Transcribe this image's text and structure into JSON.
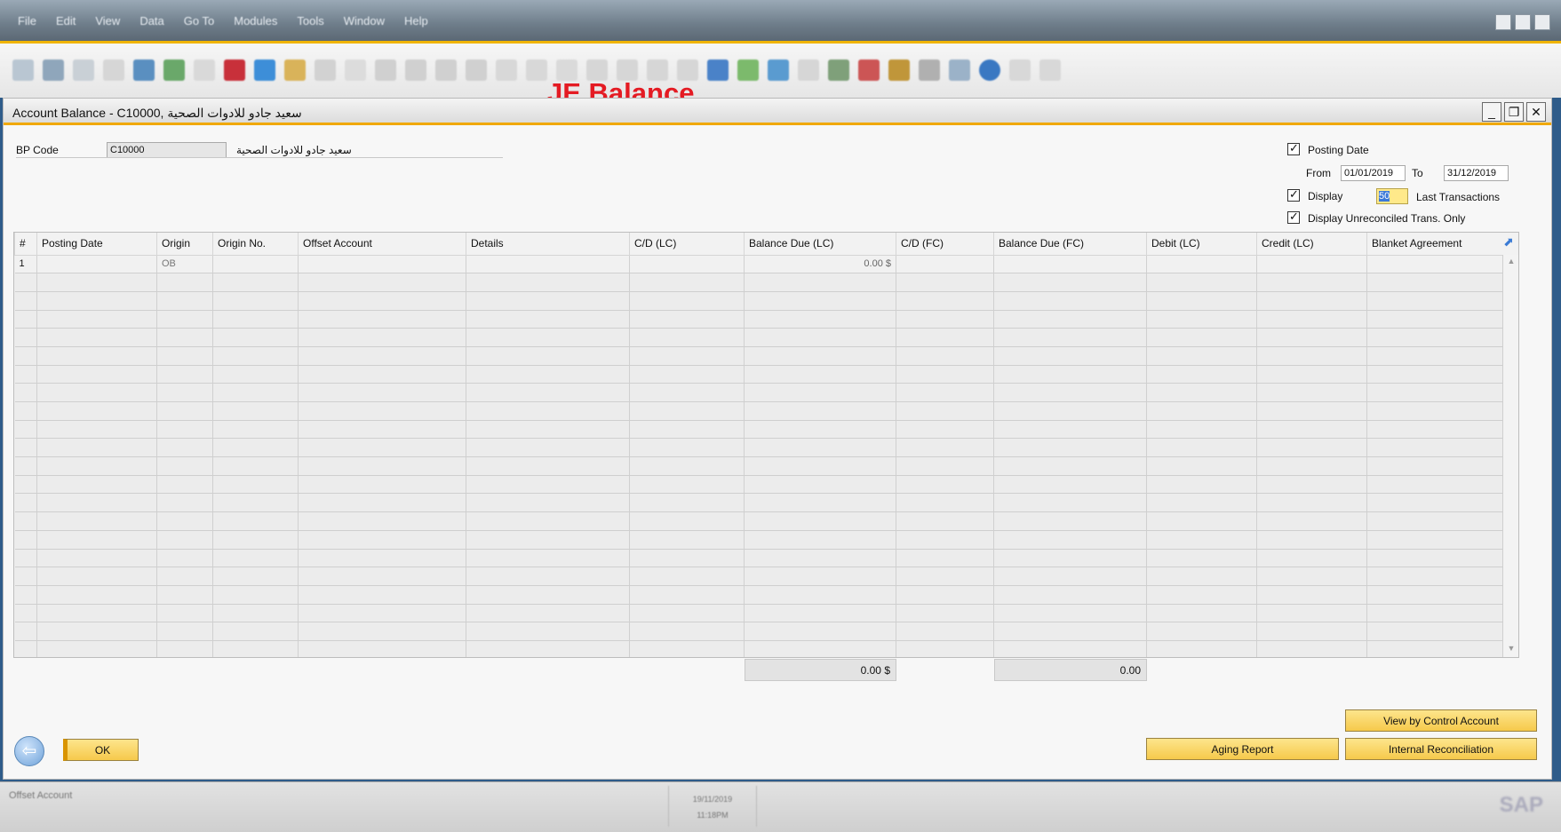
{
  "app": {
    "menus": [
      "File",
      "Edit",
      "View",
      "Data",
      "Go To",
      "Modules",
      "Tools",
      "Window",
      "Help"
    ],
    "overlay_title": "JE Balance"
  },
  "window": {
    "title": "Account Balance - C10000, سعيد جادو للادوات الصحية"
  },
  "form": {
    "bp_code_label": "BP Code",
    "bp_code_value": "C10000",
    "bp_name": "سعيد جادو للادوات الصحية",
    "posting_date_label": "Posting Date",
    "posting_date_checked": true,
    "from_label": "From",
    "from_value": "01/01/2019",
    "to_label": "To",
    "to_value": "31/12/2019",
    "display_label": "Display",
    "display_checked": true,
    "display_count": "50",
    "last_transactions_label": "Last Transactions",
    "unreconciled_label": "Display Unreconciled Trans. Only",
    "unreconciled_checked": true
  },
  "grid": {
    "columns": [
      "#",
      "Posting Date",
      "Origin",
      "Origin No.",
      "Offset Account",
      "Details",
      "C/D (LC)",
      "Balance Due (LC)",
      "C/D (FC)",
      "Balance Due (FC)",
      "Debit (LC)",
      "Credit (LC)",
      "Blanket Agreement"
    ],
    "rows": [
      [
        "1",
        "",
        "OB",
        "",
        "",
        "",
        "",
        "0.00 $",
        "",
        "",
        "",
        "",
        ""
      ]
    ],
    "total_lc": "0.00 $",
    "total_fc": "0.00"
  },
  "buttons": {
    "ok": "OK",
    "view_by_control": "View by Control Account",
    "aging_report": "Aging Report",
    "internal_reconciliation": "Internal Reconciliation"
  },
  "status": {
    "left": "Offset Account",
    "date": "19/11/2019",
    "time": "11:18PM",
    "logo": "SAP"
  },
  "colors": {
    "accent": "#f0a800",
    "button": "#f6c94b",
    "overlay_red": "#e41b23"
  }
}
